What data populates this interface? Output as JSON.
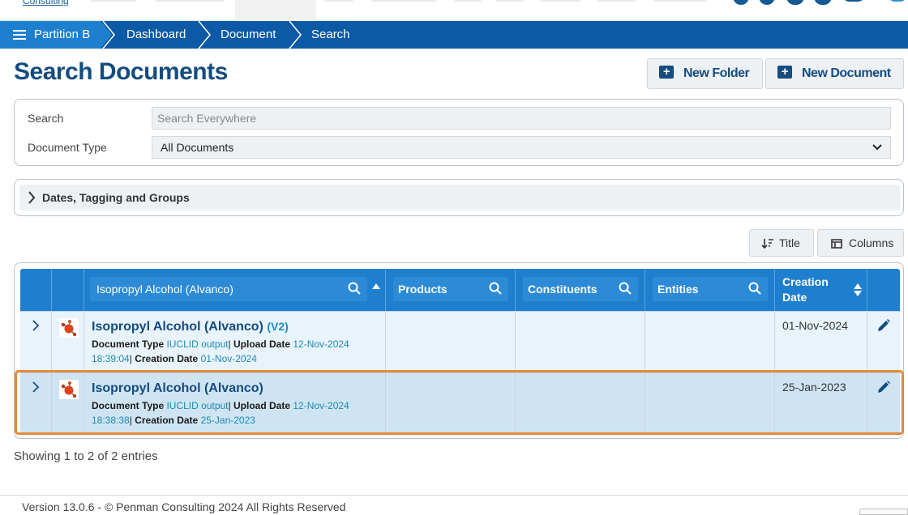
{
  "app": {
    "logo_text": "Consulting"
  },
  "breadcrumb": {
    "items": [
      "Partition B",
      "Dashboard",
      "Document",
      "Search"
    ]
  },
  "header": {
    "title": "Search Documents",
    "new_folder_label": "New Folder",
    "new_document_label": "New Document"
  },
  "search_panel": {
    "search_label": "Search",
    "search_placeholder": "Search Everywhere",
    "search_value": "",
    "doc_type_label": "Document Type",
    "doc_type_selected": "All Documents"
  },
  "accordion": {
    "label": "Dates, Tagging and Groups"
  },
  "toolbar": {
    "sort_label": "Title",
    "columns_label": "Columns"
  },
  "table": {
    "title_filter_value": "Isopropyl Alcohol (Alvanco)",
    "col_products": "Products",
    "col_constituents": "Constituents",
    "col_entities": "Entities",
    "col_creation_date_line1": "Creation",
    "col_creation_date_line2": "Date",
    "rows": [
      {
        "title": "Isopropyl Alcohol (Alvanco)",
        "version": "(V2)",
        "doc_type_label": "Document Type",
        "doc_type": "IUCLID output",
        "upload_label": "Upload Date",
        "upload_date": "12-Nov-2024",
        "upload_time": "18:39:04",
        "creation_label": "Creation Date",
        "creation_date_meta": "01-Nov-2024",
        "creation_date": "01-Nov-2024",
        "selected": false
      },
      {
        "title": "Isopropyl Alcohol (Alvanco)",
        "version": "",
        "doc_type_label": "Document Type",
        "doc_type": "IUCLID output",
        "upload_label": "Upload Date",
        "upload_date": "12-Nov-2024",
        "upload_time": "18:38:38",
        "creation_label": "Creation Date",
        "creation_date_meta": "25-Jan-2023",
        "creation_date": "25-Jan-2023",
        "selected": true
      }
    ]
  },
  "entries_text": "Showing 1 to 2 of 2 entries",
  "footer": {
    "text": "Version 13.0.6 - © Penman Consulting 2024 All Rights Reserved"
  },
  "colors": {
    "nav_blue": "#0c5aa6",
    "header_blue": "#1f7fcf",
    "title_blue": "#154c7f",
    "selection_orange": "#e08a3a"
  }
}
